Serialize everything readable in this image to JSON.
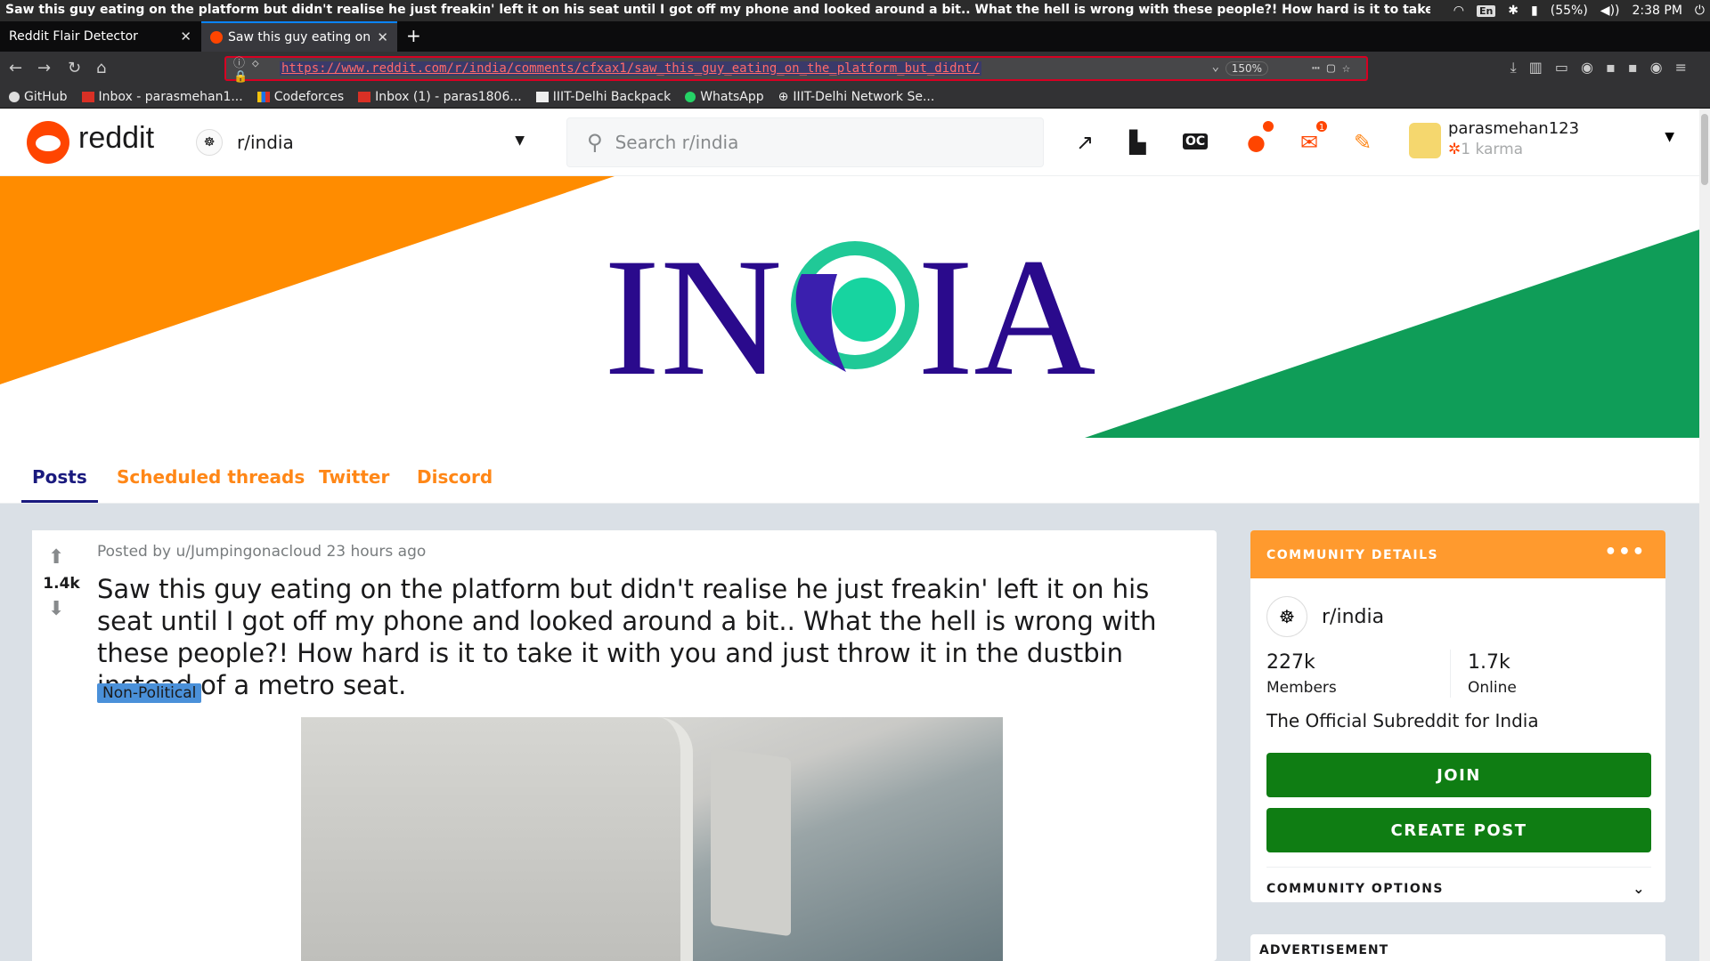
{
  "os": {
    "window_title": "Saw this guy eating on the platform but didn't realise he just freakin' left it on his seat until I got off my phone and looked around a bit.. What the hell is wrong with these people?! How hard is it to take it with you and just th",
    "lang": "En",
    "battery": "(55%)",
    "time": "2:38 PM"
  },
  "browser": {
    "tabs": [
      {
        "title": "Reddit Flair Detector"
      },
      {
        "title": "Saw this guy eating on t"
      }
    ],
    "url": "https://www.reddit.com/r/india/comments/cfxax1/saw_this_guy_eating_on_the_platform_but_didnt/",
    "zoom": "150%",
    "bookmarks": [
      {
        "label": "GitHub"
      },
      {
        "label": "Inbox - parasmehan1..."
      },
      {
        "label": "Codeforces"
      },
      {
        "label": "Inbox (1) - paras1806..."
      },
      {
        "label": "IIIT-Delhi Backpack"
      },
      {
        "label": "WhatsApp"
      },
      {
        "label": "IIIT-Delhi Network Se..."
      }
    ]
  },
  "header": {
    "logo": "reddit",
    "subreddit": "r/india",
    "search_placeholder": "Search r/india",
    "chat_badge": "",
    "mail_badge": "1",
    "username": "parasmehan123",
    "karma": "1 karma"
  },
  "banner": {
    "title": "INDIA",
    "colors": {
      "saffron": "#ff8c00",
      "green": "#0f9d58",
      "text": "#2a0a8c"
    }
  },
  "subnav": {
    "tabs": [
      {
        "label": "Posts"
      },
      {
        "label": "Scheduled threads"
      },
      {
        "label": "Twitter"
      },
      {
        "label": "Discord"
      }
    ]
  },
  "post": {
    "votes": "1.4k",
    "meta": "Posted by u/Jumpingonacloud 23 hours ago",
    "title": "Saw this guy eating on the platform but didn't realise he just freakin' left it on his seat until I got off my phone and looked around a bit.. What the hell is wrong with these people?! How hard is it to take it with you and just throw it in the dustbin instead of a metro seat.",
    "flair": "Non-Political"
  },
  "sidebar": {
    "heading": "COMMUNITY DETAILS",
    "subreddit": "r/india",
    "members_count": "227k",
    "members_label": "Members",
    "online_count": "1.7k",
    "online_label": "Online",
    "description": "The Official Subreddit for India",
    "join_label": "JOIN",
    "create_post_label": "CREATE POST",
    "options_label": "COMMUNITY OPTIONS",
    "advertisement_label": "ADVERTISEMENT"
  }
}
